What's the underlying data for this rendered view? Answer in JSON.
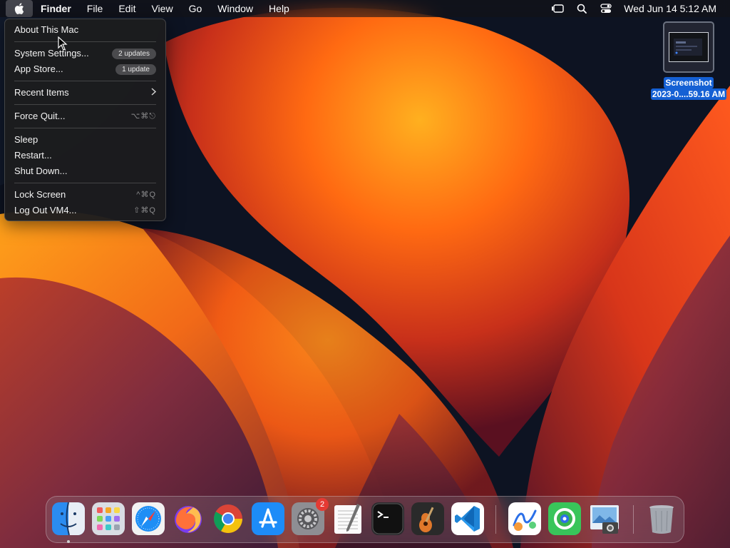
{
  "menubar": {
    "apple_icon": "apple-logo",
    "app_name": "Finder",
    "menus": [
      "File",
      "Edit",
      "View",
      "Go",
      "Window",
      "Help"
    ],
    "status_icons": [
      "stage-manager-icon",
      "spotlight-search-icon",
      "control-center-icon"
    ],
    "clock": "Wed Jun 14  5:12 AM"
  },
  "apple_menu": {
    "about": "About This Mac",
    "system_settings": "System Settings...",
    "system_settings_badge": "2 updates",
    "app_store": "App Store...",
    "app_store_badge": "1 update",
    "recent_items": "Recent Items",
    "force_quit": "Force Quit...",
    "force_quit_shortcut": "⌥⌘⎋",
    "sleep": "Sleep",
    "restart": "Restart...",
    "shut_down": "Shut Down...",
    "lock_screen": "Lock Screen",
    "lock_screen_shortcut": "^⌘Q",
    "log_out": "Log Out VM4...",
    "log_out_shortcut": "⇧⌘Q"
  },
  "desktop": {
    "file_label_line1": "Screenshot",
    "file_label_line2": "2023-0....59.16 AM"
  },
  "dock": {
    "apps": [
      {
        "name": "Finder",
        "icon": "finder-icon",
        "running": true
      },
      {
        "name": "Launchpad",
        "icon": "launchpad-icon"
      },
      {
        "name": "Safari",
        "icon": "safari-icon"
      },
      {
        "name": "Firefox",
        "icon": "firefox-icon"
      },
      {
        "name": "Chrome",
        "icon": "chrome-icon"
      },
      {
        "name": "App Store",
        "icon": "app-store-icon"
      },
      {
        "name": "System Settings",
        "icon": "system-settings-icon",
        "badge": "2"
      },
      {
        "name": "TextEdit",
        "icon": "textedit-icon"
      },
      {
        "name": "Terminal",
        "icon": "terminal-icon"
      },
      {
        "name": "GarageBand",
        "icon": "garageband-icon"
      },
      {
        "name": "Visual Studio Code",
        "icon": "vscode-icon"
      },
      {
        "name": "Freeform",
        "icon": "freeform-icon"
      },
      {
        "name": "Find My",
        "icon": "find-my-icon"
      },
      {
        "name": "Preview",
        "icon": "preview-icon"
      },
      {
        "name": "Trash",
        "icon": "trash-icon"
      }
    ]
  },
  "colors": {
    "accent_blue": "#1560d4",
    "badge_red": "#e53a33",
    "wallpaper_orange": "#f7931e"
  }
}
